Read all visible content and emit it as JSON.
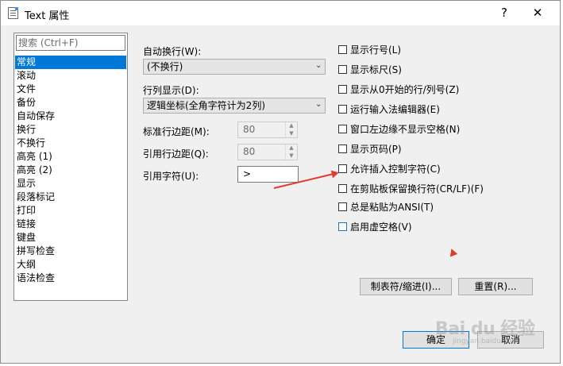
{
  "window": {
    "title": "Text 属性",
    "help": "?",
    "close": "✕"
  },
  "sidebar": {
    "search_placeholder": "搜索 (Ctrl+F)",
    "items": [
      "常规",
      "滚动",
      "文件",
      "备份",
      "自动保存",
      "换行",
      "不换行",
      "高亮 (1)",
      "高亮 (2)",
      "显示",
      "段落标记",
      "打印",
      "链接",
      "键盘",
      "拼写检查",
      "大纲",
      "语法检查"
    ],
    "selected": "常规"
  },
  "form": {
    "wrap_label": "自动换行(W):",
    "wrap_value": "(不换行)",
    "column_label": "行列显示(D):",
    "column_value": "逻辑坐标(全角字符计为2列)",
    "std_margin_label": "标准行边距(M):",
    "std_margin_value": "80",
    "quote_margin_label": "引用行边距(Q):",
    "quote_margin_value": "80",
    "quote_char_label": "引用字符(U):",
    "quote_char_value": ">"
  },
  "options": [
    "显示行号(L)",
    "显示标尺(S)",
    "显示从0开始的行/列号(Z)",
    "运行输入法编辑器(E)",
    "窗口左边缘不显示空格(N)",
    "显示页码(P)",
    "允许插入控制字符(C)",
    "在剪贴板保留换行符(CR/LF)(F)",
    "总是粘贴为ANSI(T)",
    "启用虚空格(V)"
  ],
  "buttons": {
    "tabs_indent": "制表符/缩进(I)...",
    "reset": "重置(R)...",
    "ok": "确定",
    "cancel": "取消"
  },
  "watermark": {
    "main": "Bai du 经验",
    "sub": "jingyan.baidu.com"
  }
}
